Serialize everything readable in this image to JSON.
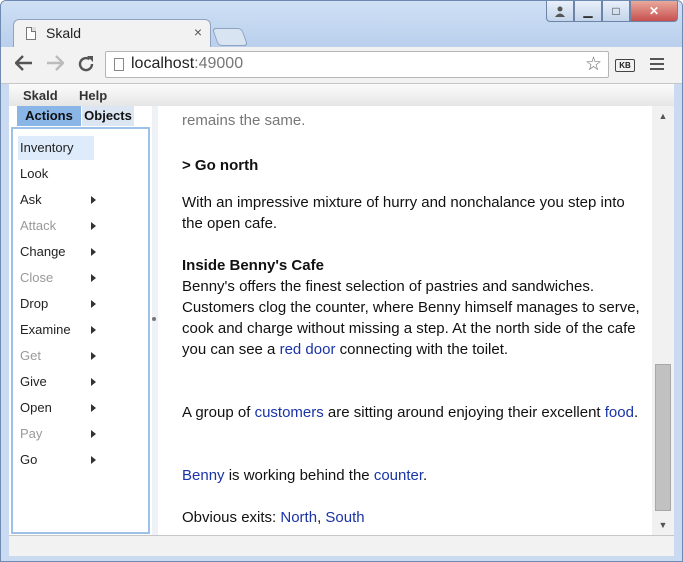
{
  "browser": {
    "tab_title": "Skald",
    "tab_close": "×",
    "url_host": "localhost",
    "url_port": ":49000",
    "kb_label": "KB",
    "window_buttons": [
      "▁",
      "□",
      "✕"
    ]
  },
  "menubar": {
    "items": [
      "Skald",
      "Help"
    ]
  },
  "panel": {
    "tabs": [
      "Actions",
      "Objects"
    ],
    "actions": [
      {
        "label": "Inventory",
        "selected": true,
        "disabled": false,
        "submenu": false
      },
      {
        "label": "Look",
        "selected": false,
        "disabled": false,
        "submenu": false
      },
      {
        "label": "Ask",
        "selected": false,
        "disabled": false,
        "submenu": true
      },
      {
        "label": "Attack",
        "selected": false,
        "disabled": true,
        "submenu": true
      },
      {
        "label": "Change",
        "selected": false,
        "disabled": false,
        "submenu": true
      },
      {
        "label": "Close",
        "selected": false,
        "disabled": true,
        "submenu": true
      },
      {
        "label": "Drop",
        "selected": false,
        "disabled": false,
        "submenu": true
      },
      {
        "label": "Examine",
        "selected": false,
        "disabled": false,
        "submenu": true
      },
      {
        "label": "Get",
        "selected": false,
        "disabled": true,
        "submenu": true
      },
      {
        "label": "Give",
        "selected": false,
        "disabled": false,
        "submenu": true
      },
      {
        "label": "Open",
        "selected": false,
        "disabled": false,
        "submenu": true
      },
      {
        "label": "Pay",
        "selected": false,
        "disabled": true,
        "submenu": true
      },
      {
        "label": "Go",
        "selected": false,
        "disabled": false,
        "submenu": true
      }
    ]
  },
  "story": {
    "prev_fragment": "remains the same.",
    "command": "> Go north",
    "transition": "With an impressive mixture of hurry and nonchalance you step into the open cafe.",
    "room_title": "Inside Benny's Cafe",
    "room_desc_1": "Benny's offers the finest selection of pastries and sandwiches.  Customers clog the counter, where Benny himself manages to serve, cook and charge without missing a step.  At the north side of the cafe you can see a ",
    "link_red_door": "red door",
    "room_desc_2": " connecting with the toilet.",
    "group_1": "A group of ",
    "link_customers": "customers",
    "group_2": " are sitting around enjoying their excellent ",
    "link_food": "food",
    "group_3": ".",
    "link_benny": "Benny",
    "benny_1": " is working behind the ",
    "link_counter": "counter",
    "benny_2": ".",
    "exits_label": "Obvious exits: ",
    "link_north": "North",
    "exits_sep": ", ",
    "link_south": "South"
  },
  "colors": {
    "link": "#1a33a6",
    "active_tab": "#8ab5e7",
    "selected_item": "#ddebfb"
  }
}
